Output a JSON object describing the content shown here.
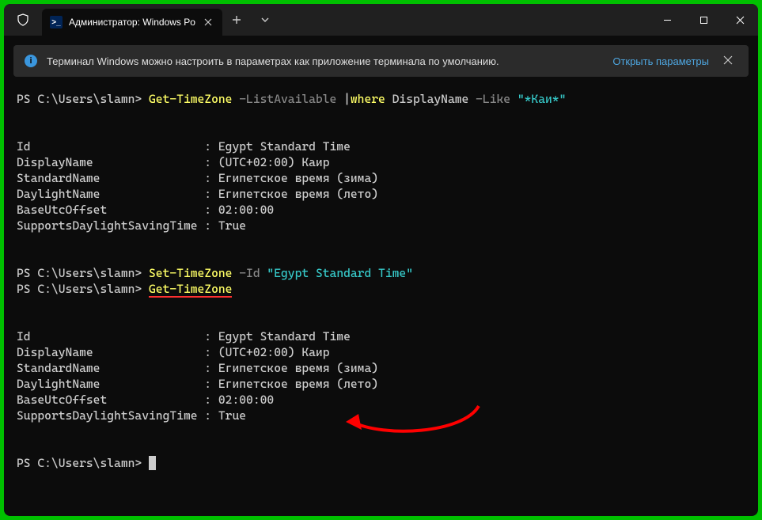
{
  "titlebar": {
    "tab_title": "Администратор: Windows Po",
    "tab_icon_glyph": ">_"
  },
  "infobar": {
    "text": "Терминал Windows можно настроить в параметрах как приложение терминала по умолчанию.",
    "link": "Открыть параметры"
  },
  "terminal": {
    "line1_prompt": "PS C:\\Users\\slamn> ",
    "line1_cmd": "Get-TimeZone",
    "line1_param1": " -ListAvailable ",
    "line1_pipe": "|",
    "line1_cmd2": "where",
    "line1_arg": " DisplayName ",
    "line1_param2": "-Like ",
    "line1_str": "\"*Каи*\"",
    "block1_l1": "Id                         : Egypt Standard Time",
    "block1_l2": "DisplayName                : (UTC+02:00) Каир",
    "block1_l3": "StandardName               : Египетское время (зима)",
    "block1_l4": "DaylightName               : Египетское время (лето)",
    "block1_l5": "BaseUtcOffset              : 02:00:00",
    "block1_l6": "SupportsDaylightSavingTime : True",
    "line2_prompt": "PS C:\\Users\\slamn> ",
    "line2_cmd": "Set-TimeZone",
    "line2_param": " -Id ",
    "line2_str": "\"Egypt Standard Time\"",
    "line3_prompt": "PS C:\\Users\\slamn> ",
    "line3_cmd": "Get-TimeZone",
    "block2_l1": "Id                         : Egypt Standard Time",
    "block2_l2": "DisplayName                : (UTC+02:00) Каир",
    "block2_l3": "StandardName               : Египетское время (зима)",
    "block2_l4": "DaylightName               : Египетское время (лето)",
    "block2_l5": "BaseUtcOffset              : 02:00:00",
    "block2_l6": "SupportsDaylightSavingTime : True",
    "line4_prompt": "PS C:\\Users\\slamn> "
  }
}
